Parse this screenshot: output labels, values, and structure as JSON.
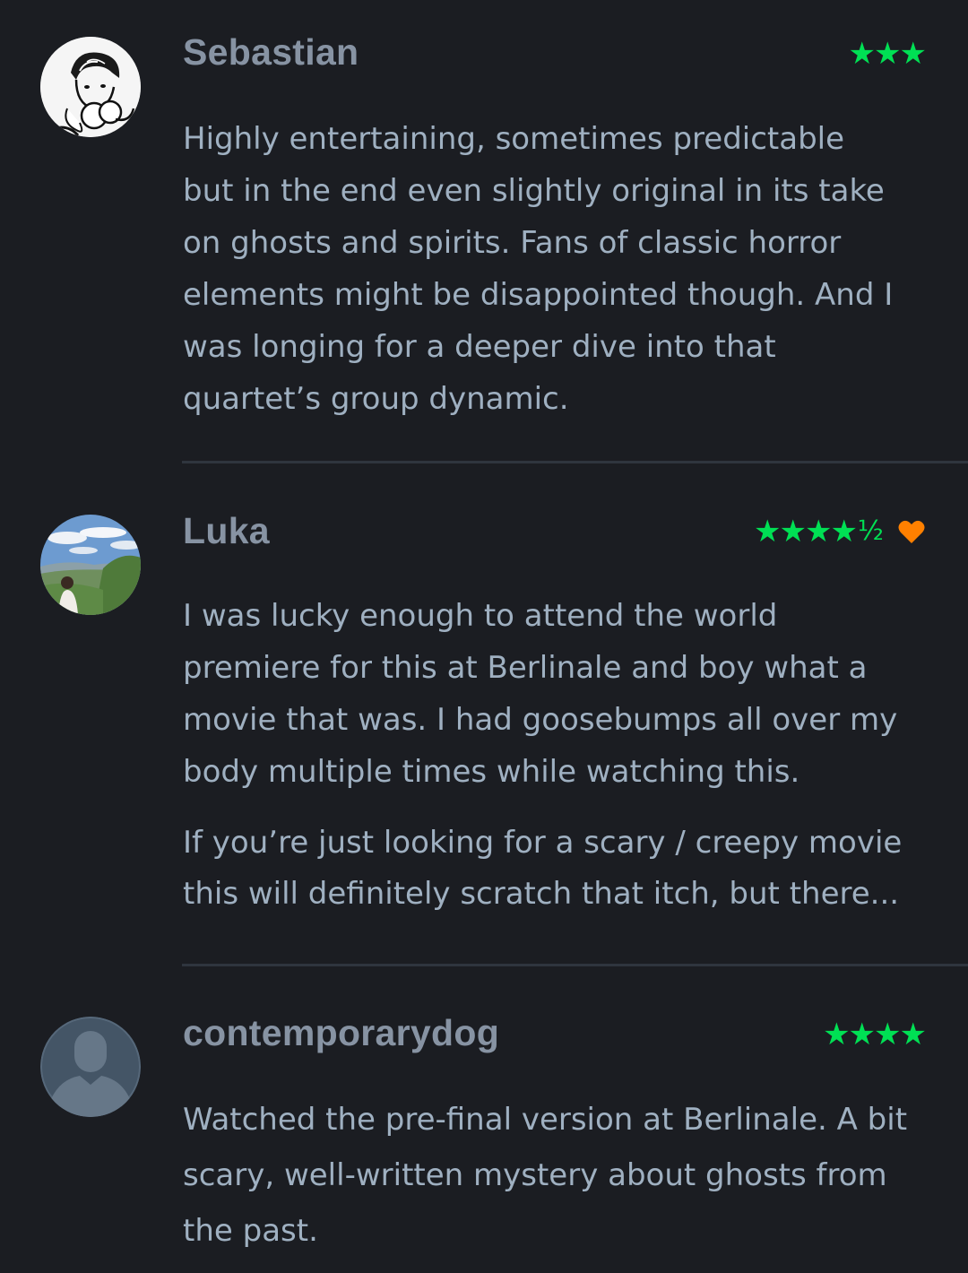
{
  "reviews": [
    {
      "author": "Sebastian",
      "rating": "★★★",
      "rating_value": 3,
      "liked": false,
      "avatar_icon": "sketch-portrait-avatar",
      "paragraphs": [
        [
          "Highly entertaining, sometimes predictable",
          "but in the end even slightly original in its take",
          "on ghosts and spirits. Fans of classic horror",
          "elements might be disappointed though. And I",
          "was longing for a deeper dive into that",
          "quartet’s group dynamic."
        ]
      ]
    },
    {
      "author": "Luka",
      "rating": "★★★★",
      "rating_half": "½",
      "rating_value": 4.5,
      "liked": true,
      "heart_color": "#ff8000",
      "avatar_icon": "landscape-photo-avatar",
      "paragraphs": [
        [
          "I was lucky enough to attend the world",
          "premiere for this at Berlinale and boy what a",
          "movie that was. I had goosebumps all over my",
          "body multiple times while watching this."
        ],
        [
          "If you’re just looking for a scary / creepy movie",
          "this will definitely scratch that itch, but there..."
        ]
      ]
    },
    {
      "author": "contemporarydog",
      "rating": "★★★★",
      "rating_value": 4,
      "liked": false,
      "avatar_icon": "default-user-avatar",
      "paragraphs": [
        [
          "Watched the pre-final version at Berlinale. A bit",
          "scary, well-written mystery about ghosts from",
          "the past."
        ]
      ]
    }
  ],
  "colors": {
    "background": "#1b1d22",
    "author": "#8793a3",
    "body": "#9fb0c1",
    "star": "#00e054",
    "heart": "#ff8000",
    "divider": "#2f353e"
  }
}
